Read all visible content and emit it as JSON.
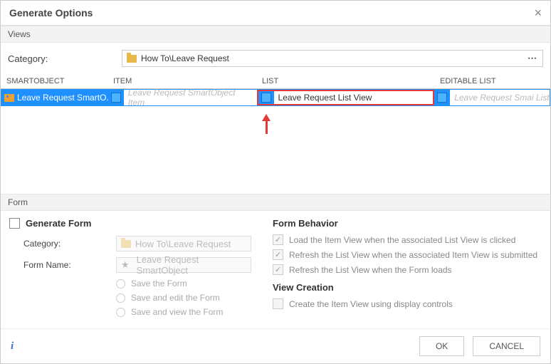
{
  "title": "Generate Options",
  "sections": {
    "views": "Views",
    "form": "Form"
  },
  "category": {
    "label": "Category:",
    "value": "How To\\Leave Request"
  },
  "grid": {
    "headers": {
      "so": "SmartObject",
      "item": "Item",
      "list": "List",
      "edit": "Editable List"
    },
    "row": {
      "so": "Leave Request SmartO...",
      "item_placeholder": "Leave Request SmartObject Item",
      "list_value": "Leave Request List View",
      "edit_placeholder": "Leave Request Smai List"
    }
  },
  "form": {
    "generate_label": "Generate Form",
    "category_label": "Category:",
    "category_value": "How To\\Leave Request",
    "name_label": "Form Name:",
    "name_value": "Leave Request SmartObject",
    "radios": {
      "save": "Save the Form",
      "save_edit": "Save and edit the Form",
      "save_view": "Save and view the Form"
    },
    "behavior": {
      "header": "Form Behavior",
      "b1": "Load the Item View when the associated List View is clicked",
      "b2": "Refresh the List View when the associated Item View is submitted",
      "b3": "Refresh the List View when the Form loads"
    },
    "view_creation": {
      "header": "View Creation",
      "c1": "Create the Item View using display controls"
    }
  },
  "buttons": {
    "ok": "OK",
    "cancel": "CANCEL"
  }
}
